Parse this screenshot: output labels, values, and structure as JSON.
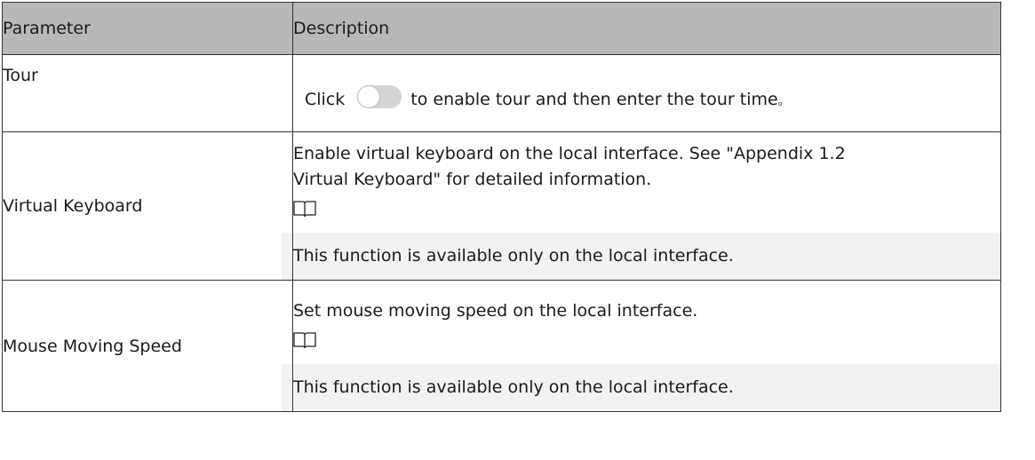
{
  "header": {
    "col1": "Parameter",
    "col2": "Description"
  },
  "rows": [
    {
      "param": "Tour",
      "desc_before": "Click",
      "toggle_state": "off",
      "desc_after": "to enable tour and then enter the tour time",
      "desc_tail": "。"
    },
    {
      "param": "Virtual Keyboard",
      "desc_line1": "Enable virtual keyboard on the local interface. See \"Appendix 1.2",
      "desc_line2": "Virtual Keyboard\" for detailed information.",
      "note_icon": "book-icon",
      "note": "This function is available only on the local interface."
    },
    {
      "param": "Mouse Moving Speed",
      "desc_line1": "Set mouse moving speed on the local interface.",
      "note_icon": "book-icon",
      "note": "This function is available only on the local interface."
    }
  ],
  "colors": {
    "header_bg": "#b8b8b8",
    "note_bg": "#f2f2f2",
    "toggle_off": "#d5d5d5"
  }
}
